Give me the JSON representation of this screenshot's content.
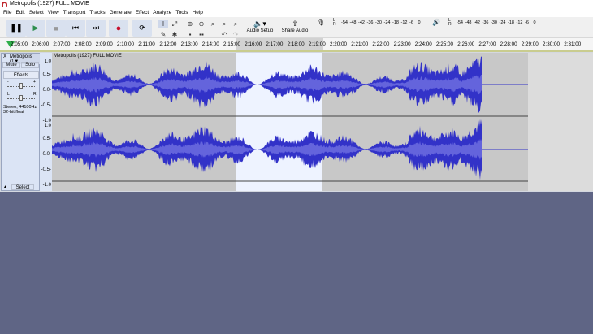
{
  "window": {
    "title": "Metropolis (1927) FULL MOVIE"
  },
  "menu": [
    "File",
    "Edit",
    "Select",
    "View",
    "Transport",
    "Tracks",
    "Generate",
    "Effect",
    "Analyze",
    "Tools",
    "Help"
  ],
  "toolbar": {
    "audio_setup": "Audio Setup",
    "share_audio": "Share Audio",
    "meter_ticks": [
      "-54",
      "-48",
      "-42",
      "-36",
      "-30",
      "-24",
      "-18",
      "-12",
      "-6",
      "0"
    ],
    "meter_lr": [
      "L",
      "R"
    ]
  },
  "ruler": {
    "ticks": [
      "2:05:00",
      "2:06:00",
      "2:07:00",
      "2:08:00",
      "2:09:00",
      "2:10:00",
      "2:11:00",
      "2:12:00",
      "2:13:00",
      "2:14:00",
      "2:15:00",
      "2:16:00",
      "2:17:00",
      "2:18:00",
      "2:19:00",
      "2:20:00",
      "2:21:00",
      "2:22:00",
      "2:23:00",
      "2:24:00",
      "2:25:00",
      "2:26:00",
      "2:27:00",
      "2:28:00",
      "2:29:00",
      "2:30:00",
      "2:31:00"
    ],
    "selection_start": "2:15:00",
    "selection_end": "2:19:10"
  },
  "track": {
    "name": "Metropolis (1927) FULL MOVIE",
    "short_name": "Metropolis (1▼",
    "mute": "Mute",
    "solo": "Solo",
    "effects": "Effects",
    "gain_labels": [
      "-",
      "+"
    ],
    "pan_labels": [
      "L",
      "R"
    ],
    "info1": "Stereo, 44100Hz",
    "info2": "32-bit float",
    "select": "Select",
    "close": "X",
    "collapse": "▲",
    "scale": [
      "1.0",
      "0.5-",
      "0.0-",
      "-0.5-",
      "-1.0"
    ],
    "waveform_color": "#3232c8",
    "rms_color": "#6464dc",
    "selection_color": "#eef3ff",
    "background_color": "#c8c8c8"
  }
}
